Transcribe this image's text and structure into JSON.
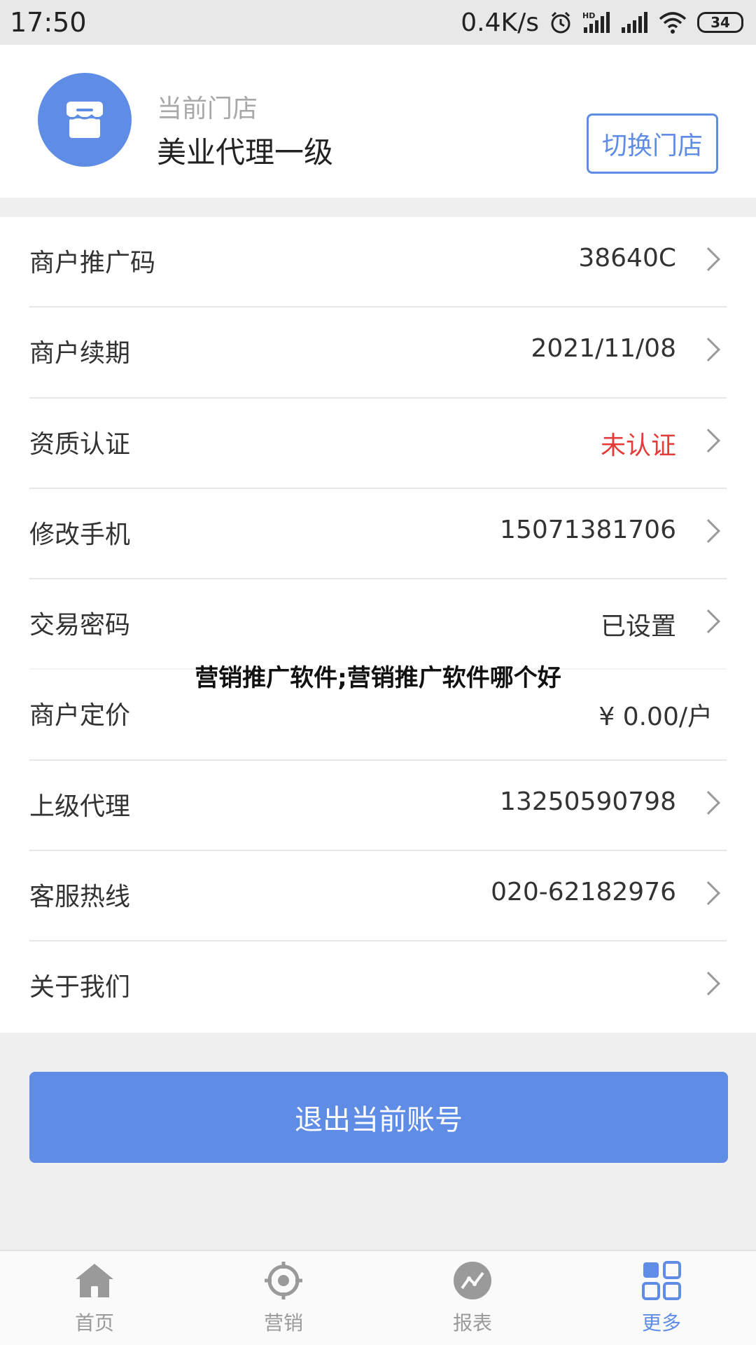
{
  "status_bar": {
    "time": "17:50",
    "network_speed": "0.4K/s",
    "battery": "34",
    "icons": [
      "alarm-icon",
      "hd-signal-icon",
      "signal-icon",
      "wifi-icon",
      "battery-icon"
    ]
  },
  "store": {
    "caption": "当前门店",
    "name": "美业代理一级",
    "switch_label": "切换门店",
    "icon": "store-icon"
  },
  "menu": [
    {
      "label": "商户推广码",
      "value": "38640C",
      "arrow": true
    },
    {
      "label": "商户续期",
      "value": "2021/11/08",
      "arrow": true
    },
    {
      "label": "资质认证",
      "value": "未认证",
      "arrow": true,
      "status_color": "#e43b3b"
    },
    {
      "label": "修改手机",
      "value": "15071381706",
      "arrow": true
    },
    {
      "label": "交易密码",
      "value": "已设置",
      "arrow": true
    },
    {
      "label": "商户定价",
      "value": "¥ 0.00/户",
      "arrow": false
    },
    {
      "label": "上级代理",
      "value": "13250590798",
      "arrow": true
    },
    {
      "label": "客服热线",
      "value": "020-62182976",
      "arrow": true
    },
    {
      "label": "关于我们",
      "value": "",
      "arrow": true
    }
  ],
  "overlay_title": "营销推广软件;营销推广软件哪个好",
  "logout_label": "退出当前账号",
  "bottom_nav": [
    {
      "label": "首页",
      "icon": "home-icon",
      "active": false
    },
    {
      "label": "营销",
      "icon": "target-icon",
      "active": false
    },
    {
      "label": "报表",
      "icon": "chart-icon",
      "active": false
    },
    {
      "label": "更多",
      "icon": "grid-icon",
      "active": true
    }
  ],
  "colors": {
    "accent": "#5f8de6",
    "danger": "#e43b3b",
    "background": "#efefef"
  }
}
